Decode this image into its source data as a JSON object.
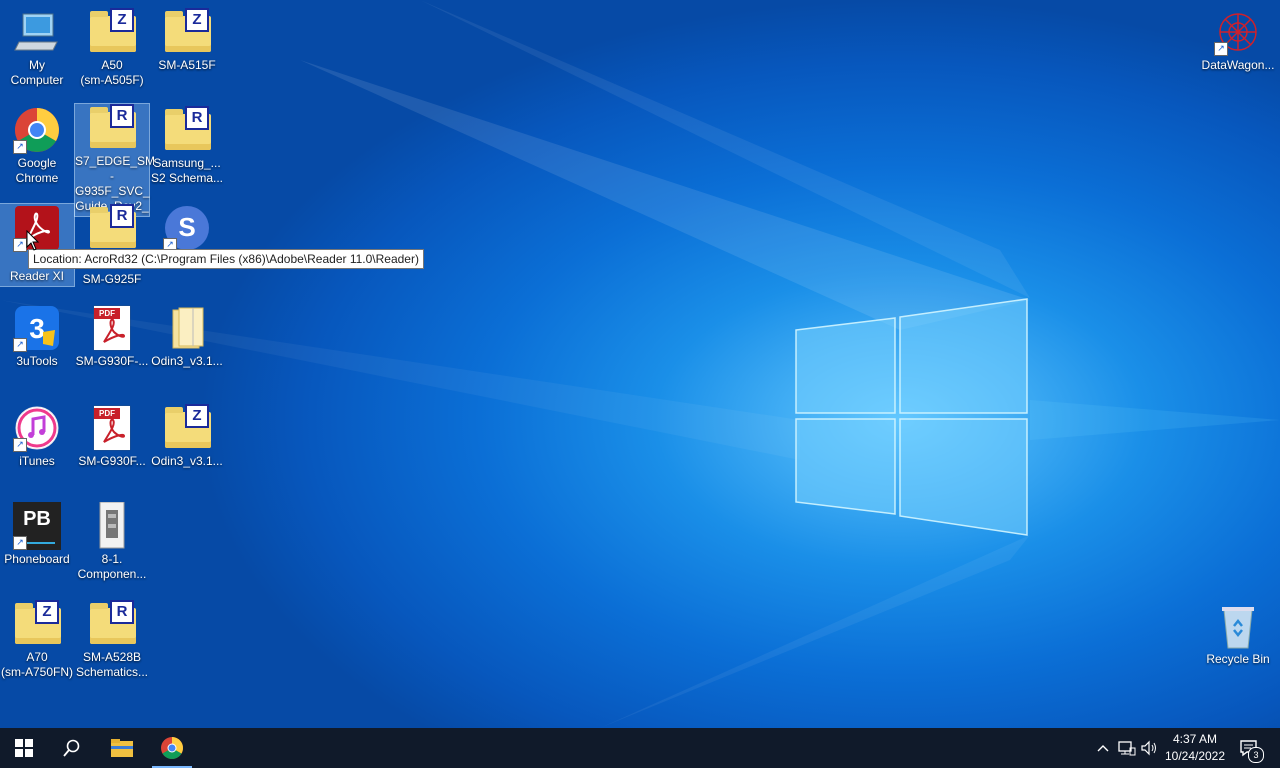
{
  "desktop": {
    "icons": [
      {
        "label": "My\nComputer"
      },
      {
        "label": "A50\n(sm-A505F)"
      },
      {
        "label": "SM-A515F"
      },
      {
        "label": "Google\nChrome"
      },
      {
        "label": "S7_EDGE_SM\n-G935F_SVC_\nGuide_Rev2_"
      },
      {
        "label": "Samsung_...\nS2 Schema..."
      },
      {
        "label": "A\nReader XI"
      },
      {
        "label": "SM-G925F"
      },
      {
        "label": ""
      },
      {
        "label": "3uTools"
      },
      {
        "label": "SM-G930F-..."
      },
      {
        "label": "Odin3_v3.1..."
      },
      {
        "label": "iTunes"
      },
      {
        "label": "SM-G930F..."
      },
      {
        "label": "Odin3_v3.1..."
      },
      {
        "label": "Phoneboard"
      },
      {
        "label": "8-1.\nComponen..."
      },
      {
        "label": "A70\n(sm-A750FN)"
      },
      {
        "label": "SM-A528B\nSchematics..."
      },
      {
        "label": "DataWagon..."
      },
      {
        "label": "Recycle Bin"
      }
    ],
    "badges": {
      "z": "Z",
      "r": "R",
      "pdf": "PDF",
      "pb": "PB",
      "three": "3",
      "s": "S"
    }
  },
  "tooltip": {
    "text": "Location: AcroRd32 (C:\\Program Files (x86)\\Adobe\\Reader 11.0\\Reader)"
  },
  "taskbar": {
    "time": "4:37 AM",
    "date": "10/24/2022",
    "notification_count": "3",
    "pinned": [
      "start-icon",
      "search-icon",
      "file-explorer-icon",
      "chrome-icon"
    ]
  },
  "colors": {
    "accent": "#0b6fd6",
    "taskbar": "#101a2a",
    "badge": "#1a2a9a"
  }
}
